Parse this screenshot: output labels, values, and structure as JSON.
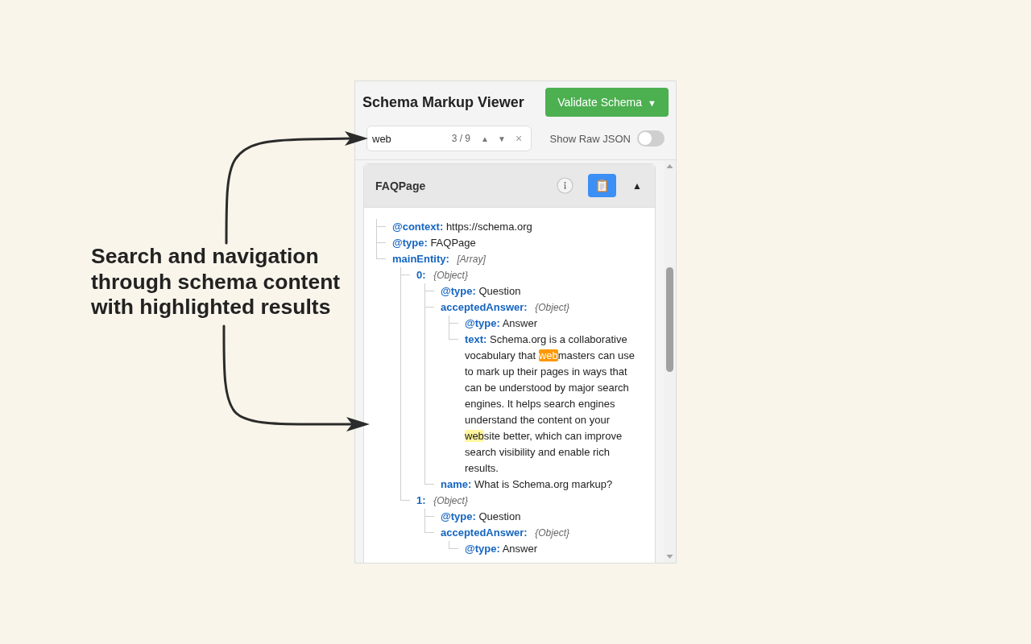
{
  "annotation": {
    "text": "Search and navigation through schema content with highlighted results"
  },
  "viewer": {
    "title": "Schema Markup Viewer",
    "validate_button": {
      "label": "Validate Schema",
      "caret": "▼"
    }
  },
  "search": {
    "value": "web",
    "match_count": "3 / 9",
    "prev": "▲",
    "next": "▼",
    "clear": "×"
  },
  "raw_json_toggle": {
    "label": "Show Raw JSON",
    "on": false
  },
  "card": {
    "title": "FAQPage",
    "toggle": "▲",
    "expanded": true,
    "tree": [
      {
        "kind": "leaf",
        "key": "@context:",
        "value": "https://schema.org"
      },
      {
        "kind": "leaf",
        "key": "@type:",
        "value": "FAQPage"
      },
      {
        "kind": "branch",
        "key": "mainEntity:",
        "hint": "[Array]",
        "children": [
          {
            "kind": "branch",
            "key": "0:",
            "hint": "{Object}",
            "children": [
              {
                "kind": "leaf",
                "key": "@type:",
                "value": "Question"
              },
              {
                "kind": "branch",
                "key": "acceptedAnswer:",
                "hint": "{Object}",
                "children": [
                  {
                    "kind": "leaf",
                    "key": "@type:",
                    "value": "Answer"
                  },
                  {
                    "kind": "leaf_matches",
                    "key": "text:",
                    "segments": [
                      {
                        "text": "Schema.org is a collaborative vocabulary that ",
                        "highlighted": false,
                        "current": false
                      },
                      {
                        "text": "web",
                        "highlighted": true,
                        "current": true
                      },
                      {
                        "text": "masters can use to mark up their pages in ways that can be understood by major search engines. It helps search engines understand the content on your ",
                        "highlighted": false,
                        "current": false
                      },
                      {
                        "text": "web",
                        "highlighted": true,
                        "current": false
                      },
                      {
                        "text": "site better, which can improve search visibility and enable rich results.",
                        "highlighted": false,
                        "current": false
                      }
                    ]
                  }
                ]
              },
              {
                "kind": "leaf",
                "key": "name:",
                "value": "What is Schema.org markup?"
              }
            ]
          },
          {
            "kind": "branch",
            "key": "1:",
            "hint": "{Object}",
            "children": [
              {
                "kind": "leaf",
                "key": "@type:",
                "value": "Question"
              },
              {
                "kind": "branch",
                "key": "acceptedAnswer:",
                "hint": "{Object}",
                "children": [
                  {
                    "kind": "leaf",
                    "key": "@type:",
                    "value": "Answer"
                  }
                ]
              }
            ]
          }
        ]
      }
    ]
  }
}
